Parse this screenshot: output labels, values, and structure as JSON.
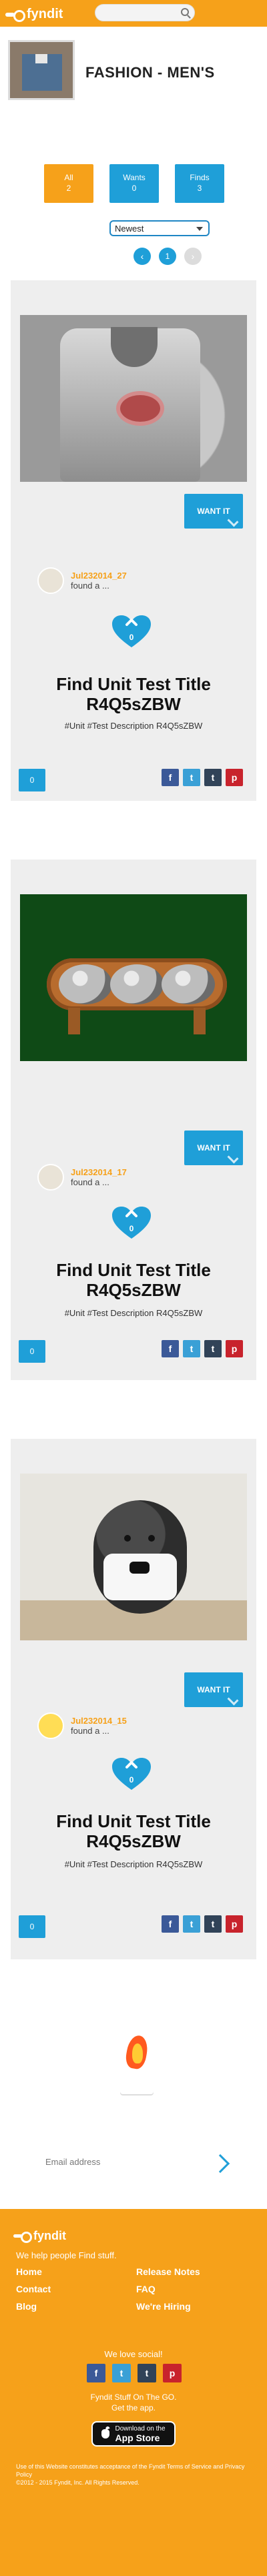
{
  "header": {
    "brand": "fyndit",
    "search_placeholder": ""
  },
  "category": {
    "title": "FASHION - MEN'S",
    "stats": [
      {
        "label": "All",
        "value": "2"
      },
      {
        "label": "Wants",
        "value": "0"
      },
      {
        "label": "Finds",
        "value": "3"
      }
    ],
    "sort_selected": "Newest",
    "pager": {
      "current": "1",
      "prev_icon": "chevron-left-icon",
      "next_icon": "chevron-right-icon"
    }
  },
  "cards": [
    {
      "want_label": "WANT IT",
      "username": "Jul232014_27",
      "found_text": "found a ...",
      "hearts": "0",
      "title": "Find Unit Test Title R4Q5sZBW",
      "description": "#Unit #Test Description R4Q5sZBW",
      "comments": "0"
    },
    {
      "want_label": "WANT IT",
      "username": "Jul232014_17",
      "found_text": "found a ...",
      "hearts": "0",
      "title": "Find Unit Test Title R4Q5sZBW",
      "description": "#Unit #Test Description R4Q5sZBW",
      "comments": "0"
    },
    {
      "want_label": "WANT IT",
      "username": "Jul232014_15",
      "found_text": "found a ...",
      "hearts": "0",
      "title": "Find Unit Test Title R4Q5sZBW",
      "description": "#Unit #Test Description R4Q5sZBW",
      "comments": "0"
    }
  ],
  "newsletter": {
    "title": "Get The Daily Hot 30 in your inbox each day",
    "email_placeholder": "Email address"
  },
  "footer": {
    "brand": "fyndit",
    "tagline": "We help people Find stuff.",
    "links": [
      "Home",
      "Release Notes",
      "Contact",
      "FAQ",
      "Blog",
      "We're Hiring"
    ],
    "love_social": "We love social!",
    "go_line_1": "Fyndit Stuff On The GO.",
    "go_line_2": "Get the app.",
    "store_line_1": "Download on the",
    "store_line_2": "App Store",
    "legal_1": "Use of this Website constitutes acceptance of the Fyndit Terms of Service and Privacy Policy",
    "legal_2": "©2012 - 2015 Fyndit, Inc. All Rights Reserved."
  },
  "colors": {
    "orange": "#f6a11a",
    "blue": "#1f9fd8"
  }
}
